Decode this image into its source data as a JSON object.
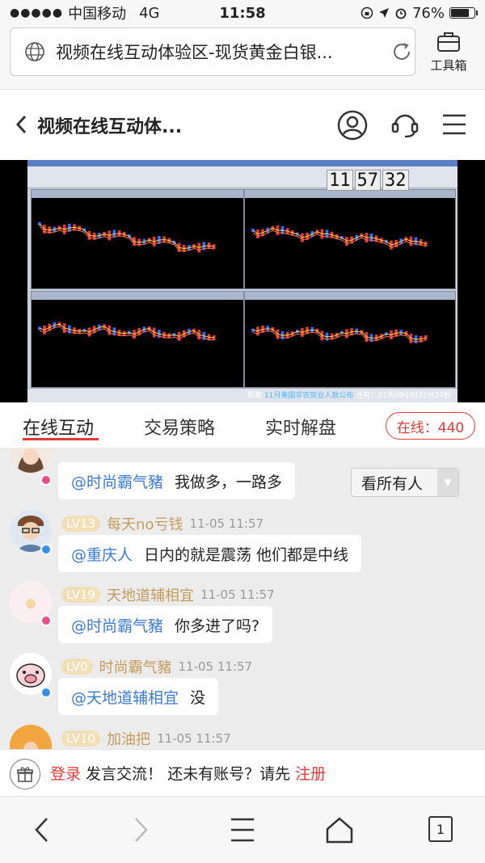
{
  "status_bar": {
    "carrier": "中国移动",
    "network": "4G",
    "time": "11:58",
    "battery": "76%"
  },
  "browser": {
    "url_title": "视频在线互动体验区-现货黄金白银...",
    "toolbox_label": "工具箱"
  },
  "header": {
    "title": "视频在线互动体..."
  },
  "video": {
    "clock": [
      "11",
      "57",
      "32"
    ],
    "ticker_label": "距离",
    "ticker_event": "11月美国非农就业人数公布",
    "ticker_rest": "还有：31天09小时32分27秒"
  },
  "tabs": {
    "items": [
      "在线互动",
      "交易策略",
      "实时解盘"
    ],
    "online_badge": "在线：440"
  },
  "chat": {
    "filter_label": "看所有人",
    "messages": [
      {
        "level": "",
        "user": "",
        "time": "",
        "mention": "@时尚霸气豬",
        "text": "我做多，一路多"
      },
      {
        "level": "LV13",
        "user": "每天no亏钱",
        "time": "11-05 11:57",
        "mention": "@重庆人",
        "text": "日内的就是震荡 他们都是中线"
      },
      {
        "level": "LV19",
        "user": "天地道辅相宜",
        "time": "11-05 11:57",
        "mention": "@时尚霸气豬",
        "text": "你多进了吗?"
      },
      {
        "level": "LV0",
        "user": "时尚霸气豬",
        "time": "11-05 11:57",
        "mention": "@天地道辅相宜",
        "text": "没"
      },
      {
        "level": "LV10",
        "user": "加油把",
        "time": "11-05 11:57",
        "mention": "",
        "text": ""
      }
    ]
  },
  "login_bar": {
    "login": "登录",
    "mid": " 发言交流！ 还未有账号？请先 ",
    "register": "注册"
  },
  "bottom_nav": {
    "tab_count": "1"
  },
  "colors": {
    "accent_red": "#e53935",
    "mention_blue": "#3a7bd5",
    "username_gold": "#c69a5b"
  }
}
